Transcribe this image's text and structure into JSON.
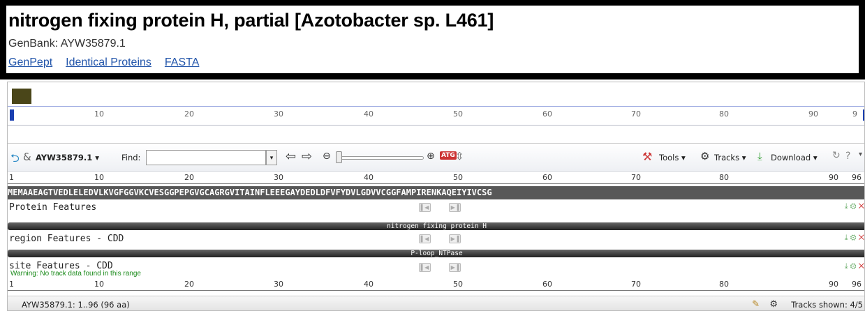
{
  "header": {
    "title": "nitrogen fixing protein H, partial [Azotobacter sp. L461]",
    "accession": "GenBank: AYW35879.1",
    "links": [
      "GenPept",
      "Identical Proteins",
      "FASTA"
    ]
  },
  "overview_ruler": {
    "ticks": [
      "10",
      "20",
      "30",
      "40",
      "50",
      "60",
      "70",
      "80",
      "90",
      "9"
    ]
  },
  "toolbar": {
    "seq_id": "AYW35879.1",
    "find_label": "Find:",
    "find_value": "",
    "tools_label": "Tools",
    "tracks_label": "Tracks",
    "download_label": "Download",
    "help_icon": "?"
  },
  "seq_ruler": {
    "ticks": [
      "1",
      "10",
      "20",
      "30",
      "40",
      "50",
      "60",
      "70",
      "80",
      "90",
      "96"
    ]
  },
  "sequence": "MEMAAEAGTVEDLELEDVLKVGFGGVKCVESGGPEPGVGCAGRGVITAINFLEEEGAYDEDLDFVFYDVLGDVVCGGFAMPIRENKAQEIYIVCSG",
  "tracks": [
    {
      "label": "Protein Features",
      "bar_label": "nitrogen fixing protein H"
    },
    {
      "label": "region Features - CDD",
      "bar_label": "P-loop_NTPase"
    },
    {
      "label": "site Features - CDD",
      "warning": "Warning: No track data found in this range"
    }
  ],
  "bottom_ruler": {
    "ticks": [
      "1",
      "10",
      "20",
      "30",
      "40",
      "50",
      "60",
      "70",
      "80",
      "90",
      "96"
    ]
  },
  "status": {
    "range": "AYW35879.1: 1..96 (96 aa)",
    "tracks_shown": "Tracks shown: 4/5"
  }
}
